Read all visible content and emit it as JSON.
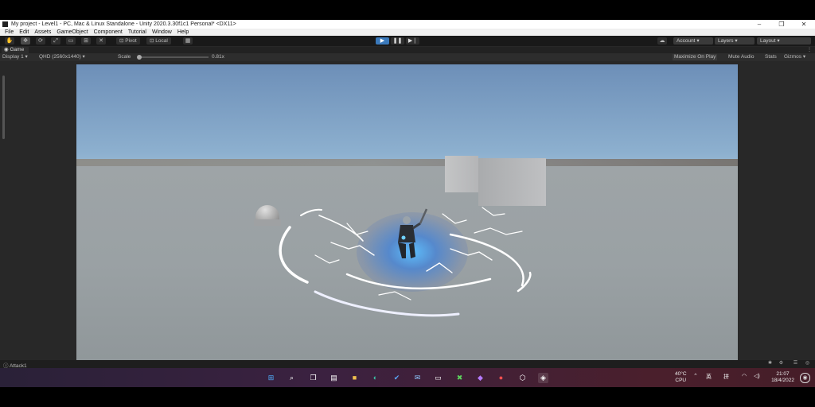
{
  "window": {
    "title": "My project - Level1 - PC, Mac & Linux Standalone - Unity 2020.3.30f1c1 Personal* <DX11>",
    "controls": [
      "–",
      "❐",
      "✕"
    ]
  },
  "menu": [
    "File",
    "Edit",
    "Assets",
    "GameObject",
    "Component",
    "Tutorial",
    "Window",
    "Help"
  ],
  "toolbar": {
    "pivot_label": "Pivot",
    "local_label": "Local",
    "account_label": "Account",
    "layers_label": "Layers",
    "layout_label": "Layout"
  },
  "game_view": {
    "tab_label": "Game",
    "display": "Display 1",
    "resolution": "QHD (2560x1440)",
    "scale_label": "Scale",
    "scale_value": "0.81x",
    "maximize_label": "Maximize On Play",
    "mute_label": "Mute Audio",
    "stats_label": "Stats",
    "gizmos_label": "Gizmos"
  },
  "status": {
    "message": "Attack1"
  },
  "taskbar": {
    "temperature": "40°C",
    "cpu_label": "CPU",
    "ime_1": "英",
    "ime_2": "拼",
    "time": "21:07",
    "date": "18/4/2022"
  },
  "colors": {
    "play_accent": "#3a79bb",
    "effect_glow": "#5abeff"
  }
}
